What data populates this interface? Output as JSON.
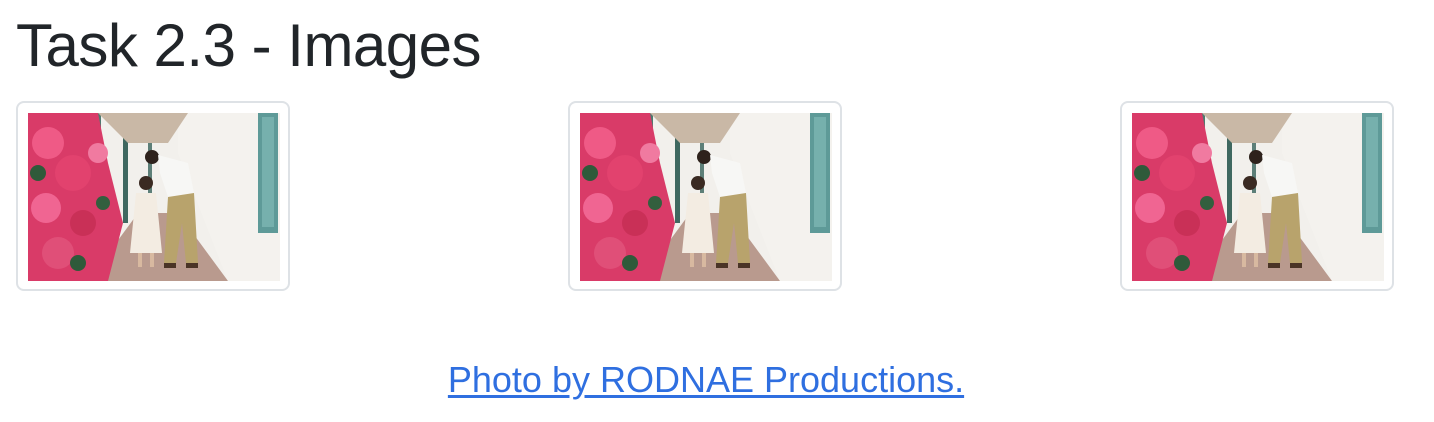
{
  "page": {
    "title": "Task 2.3 - Images"
  },
  "gallery": {
    "images": [
      {
        "alt": "Father kissing daughter beside pink flowers"
      },
      {
        "alt": "Father kissing daughter beside pink flowers"
      },
      {
        "alt": "Father kissing daughter beside pink flowers"
      }
    ]
  },
  "credit": {
    "link_text": "Photo by RODNAE Productions."
  },
  "colors": {
    "link": "#2f6fe0",
    "thumb_border": "#dee2e6",
    "text": "#212529"
  }
}
